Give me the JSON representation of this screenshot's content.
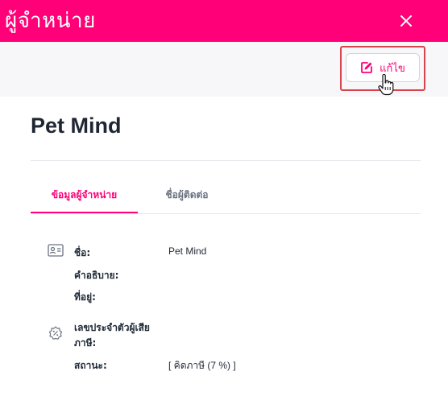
{
  "header": {
    "title": "ผู้จำหน่าย",
    "close_icon": "close-icon"
  },
  "toolbar": {
    "edit_label": "แก้ไข",
    "edit_icon": "edit-icon"
  },
  "vendor": {
    "name": "Pet Mind"
  },
  "tabs": [
    {
      "label": "ข้อมูลผู้จำหน่าย",
      "active": true
    },
    {
      "label": "ชื่อผู้ติดต่อ",
      "active": false
    }
  ],
  "details": {
    "name_label": "ชื่อ:",
    "name_value": "Pet Mind",
    "description_label": "คำอธิบาย:",
    "address_label": "ที่อยู่:",
    "tax_id_label_line1": "เลขประจำตัวผู้เสีย",
    "tax_id_label_line2": "ภาษี:",
    "status_label": "สถานะ:",
    "status_value": "[ คิดภาษี (7 %) ]"
  },
  "colors": {
    "accent": "#ff0078",
    "highlight": "#d9434b"
  }
}
